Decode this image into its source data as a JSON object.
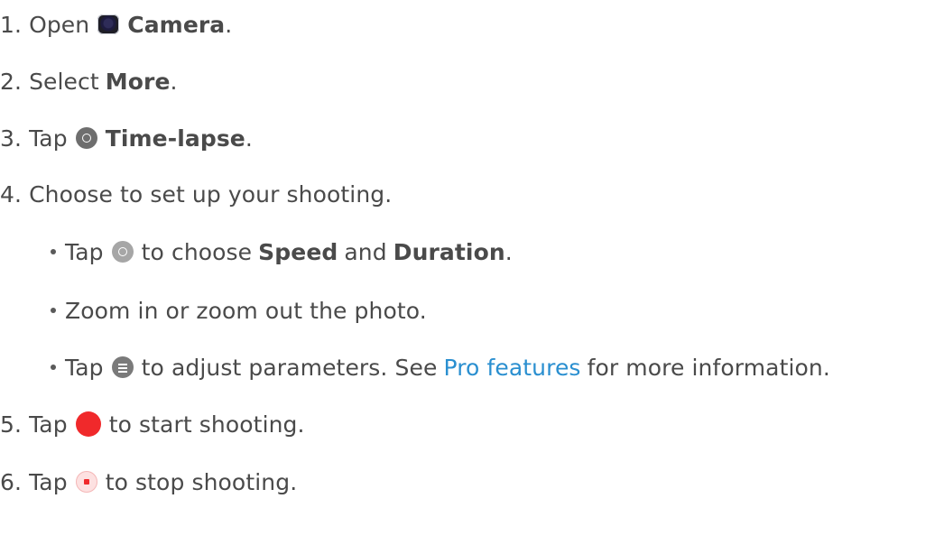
{
  "steps": [
    {
      "num": "1.",
      "pre": "Open",
      "bold": "Camera",
      "post": ".",
      "icon": "camera-icon"
    },
    {
      "num": "2.",
      "pre": "Select",
      "bold": "More",
      "post": "."
    },
    {
      "num": "3.",
      "pre": "Tap",
      "bold": "Time-lapse",
      "post": ".",
      "icon": "timelapse-icon"
    },
    {
      "num": "4.",
      "text": "Choose to set up your shooting."
    },
    {
      "num": "5.",
      "pre": "Tap",
      "post": "to start shooting.",
      "icon": "record-icon"
    },
    {
      "num": "6.",
      "pre": "Tap",
      "post": "to stop shooting.",
      "icon": "stop-icon"
    }
  ],
  "bullets": [
    {
      "pre": "Tap",
      "mid": "to choose",
      "bold1": "Speed",
      "and": "and",
      "bold2": "Duration",
      "post": ".",
      "icon": "speed-icon"
    },
    {
      "text": "Zoom in or zoom out the photo."
    },
    {
      "pre": "Tap",
      "mid": "to adjust parameters. See",
      "link": "Pro features",
      "post": "for more information.",
      "icon": "parameters-icon"
    }
  ],
  "colors": {
    "text": "#4a4a4a",
    "link": "#2a8fd0",
    "record": "#f0292b"
  }
}
